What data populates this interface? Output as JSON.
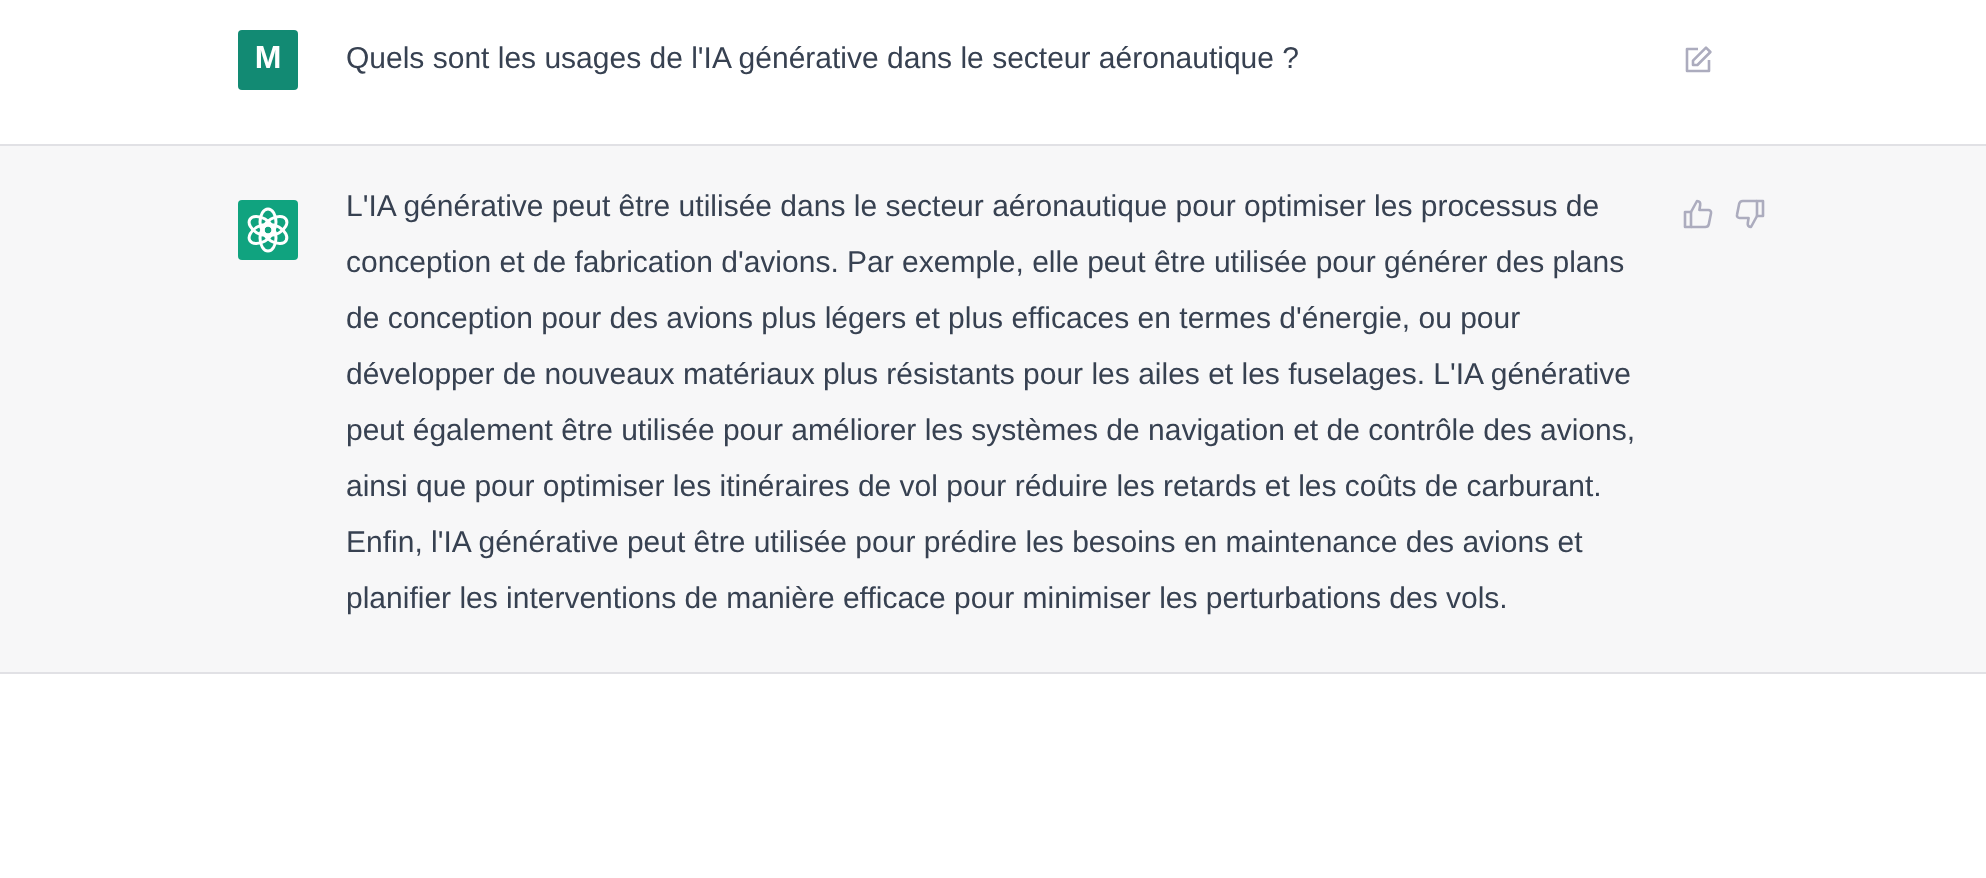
{
  "messages": [
    {
      "kind": "user",
      "avatar": "M",
      "text": "Quels sont les usages de l'IA générative dans le secteur aéronautique ?"
    },
    {
      "kind": "assistant",
      "text": "L'IA générative peut être utilisée dans le secteur aéronautique pour optimiser les processus de conception et de fabrication d'avions. Par exemple, elle peut être utilisée pour générer des plans de conception pour des avions plus légers et plus efficaces en termes d'énergie, ou pour développer de nouveaux matériaux plus résistants pour les ailes et les fuselages. L'IA générative peut également être utilisée pour améliorer les systèmes de navigation et de contrôle des avions, ainsi que pour optimiser les itinéraires de vol pour réduire les retards et les coûts de carburant. Enfin, l'IA générative peut être utilisée pour prédire les besoins en maintenance des avions et planifier les interventions de manière efficace pour minimiser les perturbations des vols."
    }
  ]
}
